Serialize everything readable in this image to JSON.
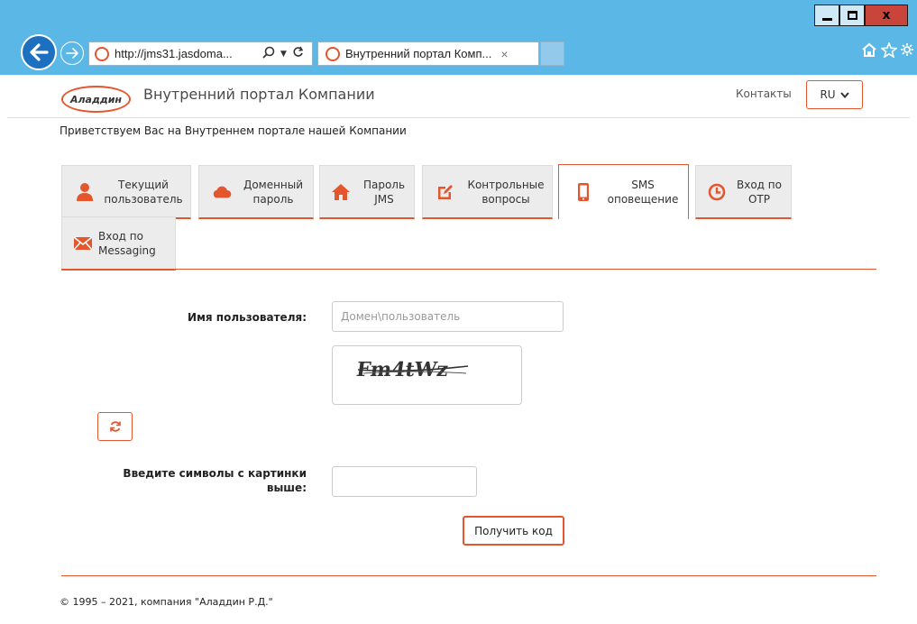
{
  "browser": {
    "url": "http://jms31.jasdoma...",
    "tab_title": "Внутренний портал Комп...",
    "tab_close": "×",
    "window": {
      "minimize": "minimize",
      "maximize": "maximize",
      "close": "x"
    },
    "icons": [
      "back-arrow-icon",
      "forward-arrow-icon",
      "search-icon",
      "refresh-icon",
      "home-icon",
      "star-icon",
      "gear-icon"
    ]
  },
  "header": {
    "logo_text": "Аладдин",
    "site_title": "Внутренний портал Компании",
    "contacts": "Контакты",
    "lang": "RU"
  },
  "welcome": "Приветствуем Вас на Внутреннем портале нашей Компании",
  "tabs": [
    {
      "label": "Текущий\nпользователь",
      "icon": "user-icon",
      "active": false
    },
    {
      "label": "Доменный\nпароль",
      "icon": "cloud-icon",
      "active": false
    },
    {
      "label": "Пароль\nJMS",
      "icon": "home-icon",
      "active": false
    },
    {
      "label": "Контрольные\nвопросы",
      "icon": "edit-icon",
      "active": false
    },
    {
      "label": "SMS\nоповещение",
      "icon": "mobile-icon",
      "active": true
    },
    {
      "label": "Вход по\nOTP",
      "icon": "clock-icon",
      "active": false
    },
    {
      "label": "Вход по\nMessaging",
      "icon": "envelope-icon",
      "active": false
    }
  ],
  "form": {
    "username_label": "Имя пользователя:",
    "username_placeholder": "Домен\\пользователь",
    "captcha_text": "Fm4tWz",
    "captcha_label": "Введите символы с картинки\nвыше:",
    "captcha_value": "",
    "submit_label": "Получить код"
  },
  "footer": {
    "copyright": "© 1995 – 2021, компания \"Аладдин Р.Д.\""
  },
  "colors": {
    "accent": "#e4572e",
    "chrome": "#5bb8e6",
    "tab_bg": "#ececec"
  }
}
